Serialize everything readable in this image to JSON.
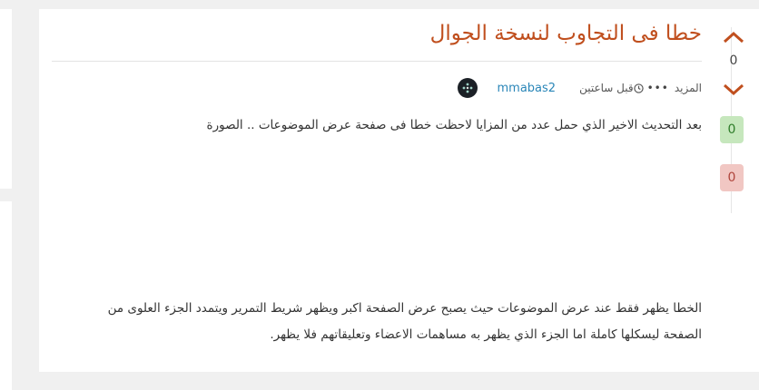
{
  "post": {
    "title": "خطا فى التجاوب لنسخة الجوال",
    "author": "mmabas2",
    "time": "قبل ساعتين",
    "more_label": "المزيد",
    "paragraph1": "بعد التحديث الاخير الذي حمل عدد من المزايا لاحظت خطا فى صفحة عرض الموضوعات .. الصورة",
    "paragraph2": "الخطا يظهر فقط عند عرض الموضوعات حيث يصبح عرض الصفحة اكبر ويظهر شريط التمرير ويتمدد الجزء العلوى من الصفحة ليسكلها كاملة اما الجزء الذي يظهر به مساهمات الاعضاء وتعليقاتهم فلا يظهر."
  },
  "votes": {
    "score": "0",
    "up_count": "0",
    "down_count": "0"
  },
  "icons": {
    "upvote": "chevron-up-icon",
    "downvote": "chevron-down-icon",
    "time": "clock-icon",
    "more": "ellipsis-icon"
  },
  "colors": {
    "title": "#c04f1e",
    "author": "#2a86b8",
    "upvote_badge_bg": "#c6e7bd",
    "downvote_badge_bg": "#f1c7c3"
  }
}
